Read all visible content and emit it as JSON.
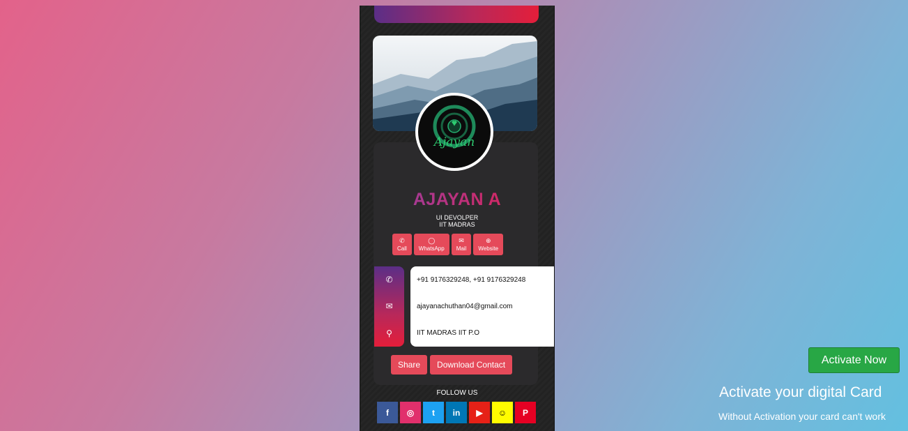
{
  "profile": {
    "name": "AJAYAN A",
    "role": "UI DEVOLPER",
    "org": "IIT MADRAS",
    "logo_text": "Ajayan"
  },
  "actions": [
    {
      "label": "Call",
      "icon": "phone-icon"
    },
    {
      "label": "WhatsApp",
      "icon": "whatsapp-icon"
    },
    {
      "label": "Mail",
      "icon": "mail-icon"
    },
    {
      "label": "Website",
      "icon": "globe-icon"
    }
  ],
  "contact": {
    "phone": "+91 9176329248, +91 9176329248",
    "email": "ajayanachuthan04@gmail.com",
    "address": "IIT MADRAS IIT P.O"
  },
  "buttons": {
    "share": "Share",
    "download": "Download Contact"
  },
  "follow_label": "FOLLOW US",
  "socials": [
    {
      "name": "facebook-icon",
      "glyph": "f",
      "color": "#3b5998"
    },
    {
      "name": "instagram-icon",
      "glyph": "◎",
      "color": "#e1306c"
    },
    {
      "name": "twitter-icon",
      "glyph": "t",
      "color": "#1da1f2"
    },
    {
      "name": "linkedin-icon",
      "glyph": "in",
      "color": "#0077b5"
    },
    {
      "name": "youtube-icon",
      "glyph": "▶",
      "color": "#e62117"
    },
    {
      "name": "snapchat-icon",
      "glyph": "☺",
      "color": "#fffc00"
    },
    {
      "name": "pinterest-icon",
      "glyph": "P",
      "color": "#e60023"
    }
  ],
  "activation": {
    "button": "Activate Now",
    "title": "Activate your digital Card",
    "subtitle": "Without Activation your card can't work"
  },
  "colors": {
    "accent": "#e54a5a",
    "activate_green": "#28a745"
  }
}
